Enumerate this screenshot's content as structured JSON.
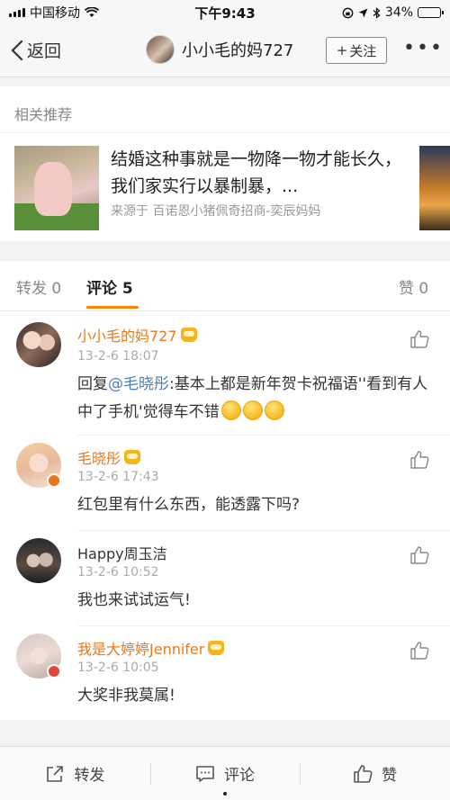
{
  "status_bar": {
    "carrier": "中国移动",
    "time": "下午9:43",
    "battery_percent": "34%",
    "battery_level": 0.34
  },
  "nav": {
    "back_label": "返回",
    "title": "小小毛的妈727",
    "follow_label": "关注",
    "follow_prefix": "+",
    "more_label": "•••"
  },
  "related": {
    "header": "相关推荐",
    "card": {
      "title": "结婚这种事就是一物降一物才能长久， 我们家实行以暴制暴，...",
      "source": "来源于 百诺恩小猪佩奇招商-奕辰妈妈"
    }
  },
  "tabs": {
    "repost": "转发 0",
    "comment": "评论 5",
    "like": "赞 0"
  },
  "comments": [
    {
      "name": "小小毛的妈727",
      "time": "13-2-6 18:07",
      "text_prefix": "回复",
      "mention": "@毛晓彤",
      "text": ":基本上都是新年贺卡祝福语''看到有人中了手机'觉得车不错"
    },
    {
      "name": "毛晓彤",
      "time": "13-2-6 17:43",
      "text": "红包里有什么东西，能透露下吗?"
    },
    {
      "name": "Happy周玉洁",
      "time": "13-2-6 10:52",
      "text": "我也来试试运气!"
    },
    {
      "name": "我是大婷婷Jennifer",
      "time": "13-2-6 10:05",
      "text": "大奖非我莫属!"
    }
  ],
  "bottom_bar": {
    "repost": "转发",
    "comment": "评论",
    "like": "赞"
  },
  "colors": {
    "accent": "#ff8200",
    "vip_name": "#e67a1f",
    "mention": "#4a7fb8"
  }
}
